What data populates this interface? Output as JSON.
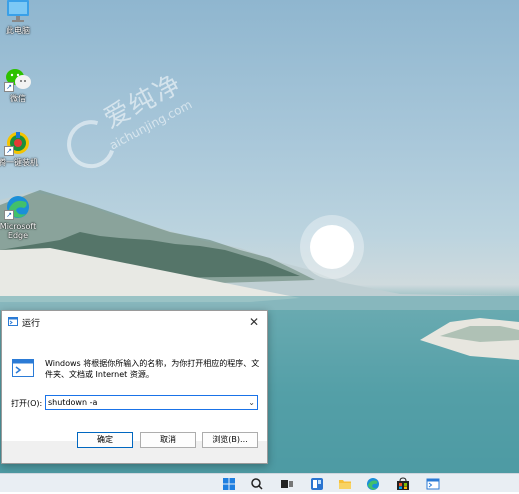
{
  "desktop": {
    "icons": [
      {
        "label": "此电脑"
      },
      {
        "label": "微信"
      },
      {
        "label": "腾一键装机"
      },
      {
        "label": "Microsoft Edge"
      }
    ],
    "watermark_cn": "爱纯净",
    "watermark_en": "aichunjing.com"
  },
  "run_dialog": {
    "title": "运行",
    "close_glyph": "✕",
    "description": "Windows 将根据你所输入的名称，为你打开相应的程序、文件夹、文档或 Internet 资源。",
    "open_label": "打开(O):",
    "command_value": "shutdown -a",
    "ok_label": "确定",
    "cancel_label": "取消",
    "browse_label": "浏览(B)..."
  },
  "taskbar": {
    "items": [
      "start-icon",
      "search-icon",
      "task-view-icon",
      "widgets-icon",
      "file-explorer-icon",
      "edge-icon",
      "store-icon",
      "run-icon"
    ]
  },
  "colors": {
    "accent": "#0067c0",
    "input_border": "#1a73e8"
  }
}
